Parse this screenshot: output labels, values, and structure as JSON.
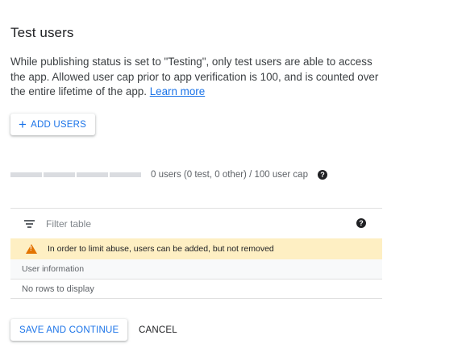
{
  "section": {
    "title": "Test users",
    "description": "While publishing status is set to \"Testing\", only test users are able to access the app. Allowed user cap prior to app verification is 100, and is counted over the entire lifetime of the app.",
    "learn_more": "Learn more"
  },
  "add_users": {
    "icon": "+",
    "label": "ADD USERS"
  },
  "user_cap": {
    "used": 0,
    "cap": 100,
    "text": "0 users (0 test, 0 other) / 100 user cap",
    "help_icon": "?"
  },
  "table": {
    "filter_placeholder": "Filter table",
    "help_icon": "?",
    "warning": "In order to limit abuse, users can be added, but not removed",
    "column_header": "User information",
    "empty_message": "No rows to display"
  },
  "actions": {
    "save": "SAVE AND CONTINUE",
    "cancel": "CANCEL"
  },
  "colors": {
    "accent": "#1a73e8",
    "warning_bg": "#feefc3",
    "warning_icon": "#e37400"
  }
}
